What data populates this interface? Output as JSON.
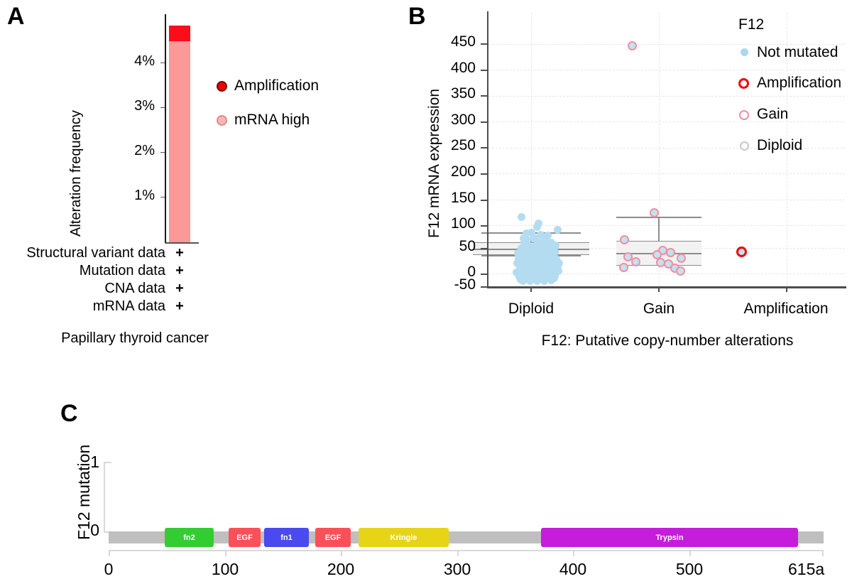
{
  "figure": {
    "panelA_letter": "A",
    "panelB_letter": "B",
    "panelC_letter": "C"
  },
  "panelA": {
    "ylabel": "Alteration frequency",
    "yticks": [
      "4%",
      "3%",
      "2%",
      "1%"
    ],
    "ytick_values": [
      4,
      3,
      2,
      1
    ],
    "ymax": 4.8,
    "caption": "Papillary thyroid cancer",
    "legend": [
      {
        "label": "Amplification",
        "color": "#ee0000",
        "ring": "#7a0606"
      },
      {
        "label": "mRNA high",
        "color": "#fbb6b6",
        "ring": "#e08b8b"
      }
    ],
    "data_rows": [
      {
        "label": "Structural variant data",
        "mark": "+"
      },
      {
        "label": "Mutation data",
        "mark": "+"
      },
      {
        "label": "CNA data",
        "mark": "+"
      },
      {
        "label": "mRNA data",
        "mark": "+"
      }
    ],
    "bar": {
      "mrna_high_pct": 4.48,
      "amplification_pct": 0.34,
      "total_pct": 4.82,
      "mrna_color": "#fb9898",
      "amp_color": "#fb0d1b"
    }
  },
  "panelB": {
    "legend_title": "F12",
    "legend": [
      {
        "label": "Not mutated",
        "style": "filled",
        "fill": "#b4dcf0",
        "ring": "#b4dcf0"
      },
      {
        "label": "Amplification",
        "style": "open",
        "fill": "#ffffff",
        "ring": "#f40000"
      },
      {
        "label": "Gain",
        "style": "open",
        "fill": "#ffffff",
        "ring": "#f48ea0"
      },
      {
        "label": "Diploid",
        "style": "open",
        "fill": "#ffffff",
        "ring": "#c9c9c9"
      }
    ],
    "boxplots": [
      {
        "category": "Diploid",
        "q1": 5,
        "median": 16,
        "q3": 27,
        "whisker_low": -2,
        "whisker_high": 50
      },
      {
        "category": "Gain",
        "q1": 7,
        "median": 22,
        "q3": 40,
        "whisker_low": 7,
        "whisker_high": 84
      },
      {
        "category": "Amplification",
        "q1": null,
        "median": null,
        "q3": null,
        "whisker_low": null,
        "whisker_high": null
      }
    ]
  },
  "panelC": {
    "ylabel": "F12 mutation",
    "yticks": [
      "1",
      "0"
    ],
    "protein_length": 615,
    "length_label": "615a",
    "xticks": [
      0,
      100,
      200,
      300,
      400,
      500
    ],
    "xtick_labels": [
      "0",
      "100",
      "200",
      "300",
      "400",
      "500"
    ],
    "backbone_color": "#bfbfbf",
    "domains": [
      {
        "name": "fn2",
        "start": 48,
        "end": 90,
        "color": "#33cc33"
      },
      {
        "name": "EGF",
        "start": 103,
        "end": 130,
        "color": "#fb5058"
      },
      {
        "name": "fn1",
        "start": 134,
        "end": 172,
        "color": "#4a4aee"
      },
      {
        "name": "EGF",
        "start": 178,
        "end": 208,
        "color": "#fb5058"
      },
      {
        "name": "Kringle",
        "start": 215,
        "end": 292,
        "color": "#e8d417"
      },
      {
        "name": "Trypsin",
        "start": 372,
        "end": 593,
        "color": "#c51ddb"
      }
    ]
  },
  "chart_data": [
    {
      "type": "bar",
      "panel": "A",
      "title": "",
      "xlabel": "Papillary thyroid cancer",
      "ylabel": "Alteration frequency",
      "categories": [
        "Papillary thyroid cancer"
      ],
      "ylim": [
        0,
        4.8
      ],
      "grid": false,
      "legend_position": "right",
      "tick_labels_y": [
        "1%",
        "2%",
        "3%",
        "4%"
      ],
      "series": [
        {
          "name": "mRNA high",
          "values": [
            4.48
          ],
          "color": "#fb9898"
        },
        {
          "name": "Amplification",
          "values": [
            0.34
          ],
          "color": "#fb0d1b"
        }
      ],
      "annotations": [
        "Structural variant data +",
        "Mutation data +",
        "CNA data +",
        "mRNA data +"
      ]
    },
    {
      "type": "scatter",
      "panel": "B",
      "title": "",
      "xlabel": "F12: Putative copy-number alterations",
      "ylabel": "F12 mRNA expression",
      "legend_title": "F12",
      "legend_position": "right",
      "grid": true,
      "categories": [
        "Diploid",
        "Gain",
        "Amplification"
      ],
      "ylim": [
        -50,
        470
      ],
      "ytick_labels": [
        "-50",
        "0",
        "50",
        "100",
        "150",
        "200",
        "250",
        "300",
        "350",
        "400",
        "450"
      ],
      "ytick_values": [
        -50,
        0,
        50,
        100,
        150,
        200,
        250,
        300,
        350,
        400,
        450
      ],
      "series": [
        {
          "name": "Diploid",
          "ring_color": "#c9c9c9",
          "fill_color": "#b4dcf0",
          "n": 120,
          "values": [
            78,
            62,
            60,
            55,
            52,
            50,
            48,
            47,
            46,
            45,
            44,
            43,
            42,
            41,
            40,
            39,
            38,
            38,
            37,
            36,
            36,
            35,
            35,
            34,
            34,
            33,
            33,
            32,
            32,
            31,
            31,
            30,
            30,
            30,
            29,
            29,
            28,
            28,
            28,
            27,
            27,
            27,
            26,
            26,
            26,
            25,
            25,
            25,
            24,
            24,
            24,
            23,
            23,
            23,
            22,
            22,
            22,
            21,
            21,
            21,
            20,
            20,
            20,
            20,
            19,
            19,
            19,
            18,
            18,
            18,
            18,
            17,
            17,
            17,
            16,
            16,
            16,
            16,
            15,
            15,
            15,
            14,
            14,
            14,
            14,
            13,
            13,
            13,
            12,
            12,
            12,
            11,
            11,
            11,
            10,
            10,
            10,
            9,
            9,
            9,
            8,
            8,
            8,
            7,
            7,
            7,
            6,
            6,
            5,
            5,
            5,
            4,
            4,
            3,
            3,
            2,
            2,
            1,
            1,
            0
          ]
        },
        {
          "name": "Gain",
          "ring_color": "#f48ea0",
          "fill_color": "#c2e2f2",
          "n": 14,
          "values": [
            430,
            113,
            56,
            42,
            38,
            35,
            33,
            28,
            24,
            22,
            18,
            14,
            11,
            9
          ]
        },
        {
          "name": "Amplification",
          "ring_color": "#f40000",
          "fill_color": "#c2e2f2",
          "n": 1,
          "values": [
            18
          ]
        }
      ],
      "boxplots": [
        {
          "category": "Diploid",
          "q1": 5,
          "median": 16,
          "q3": 27,
          "whisker_low": -2,
          "whisker_high": 50
        },
        {
          "category": "Gain",
          "q1": 7,
          "median": 22,
          "q3": 40,
          "whisker_low": 7,
          "whisker_high": 84
        }
      ]
    },
    {
      "type": "bar",
      "panel": "C",
      "title": "",
      "xlabel": "",
      "ylabel": "F12 mutation",
      "ylim": [
        0,
        1
      ],
      "xlim": [
        0,
        615
      ],
      "grid": false,
      "categories": [
        "fn2",
        "EGF",
        "fn1",
        "EGF",
        "Kringle",
        "Trypsin"
      ],
      "values": [
        0,
        0,
        0,
        0,
        0,
        0
      ],
      "note": "Lollipop / protein domain diagram; no mutations plotted"
    }
  ]
}
